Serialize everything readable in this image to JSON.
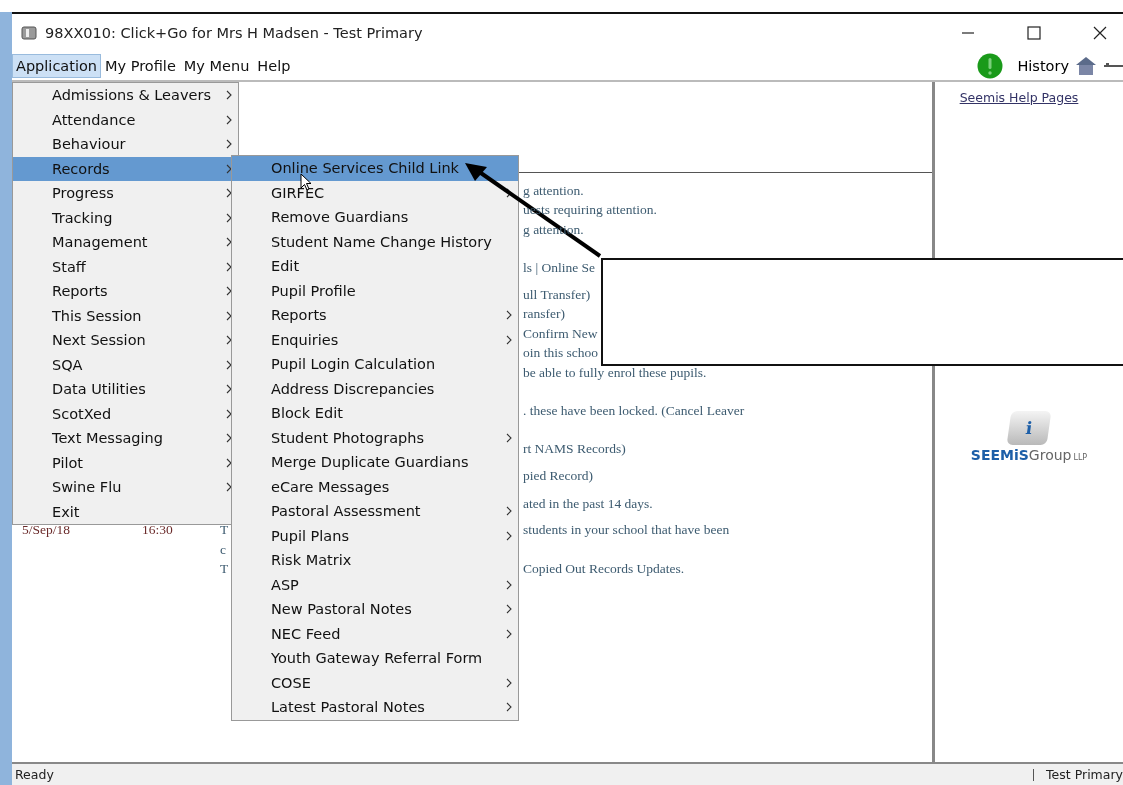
{
  "window": {
    "title": "98XX010: Click+Go for Mrs H Madsen - Test Primary"
  },
  "menubar": [
    {
      "label": "Application",
      "selected": true
    },
    {
      "label": "My Profile",
      "selected": false
    },
    {
      "label": "My Menu",
      "selected": false
    },
    {
      "label": "Help",
      "selected": false
    }
  ],
  "toolbar": {
    "history": "History"
  },
  "application_menu": [
    {
      "label": "Admissions & Leavers",
      "submenu": true,
      "selected": false
    },
    {
      "label": "Attendance",
      "submenu": true,
      "selected": false
    },
    {
      "label": "Behaviour",
      "submenu": true,
      "selected": false
    },
    {
      "label": "Records",
      "submenu": true,
      "selected": true
    },
    {
      "label": "Progress",
      "submenu": true,
      "selected": false
    },
    {
      "label": "Tracking",
      "submenu": true,
      "selected": false
    },
    {
      "label": "Management",
      "submenu": true,
      "selected": false
    },
    {
      "label": "Staff",
      "submenu": true,
      "selected": false
    },
    {
      "label": "Reports",
      "submenu": true,
      "selected": false
    },
    {
      "label": "This Session",
      "submenu": true,
      "selected": false
    },
    {
      "label": "Next Session",
      "submenu": true,
      "selected": false
    },
    {
      "label": "SQA",
      "submenu": true,
      "selected": false
    },
    {
      "label": "Data Utilities",
      "submenu": true,
      "selected": false
    },
    {
      "label": "ScotXed",
      "submenu": true,
      "selected": false
    },
    {
      "label": "Text Messaging",
      "submenu": true,
      "selected": false
    },
    {
      "label": "Pilot",
      "submenu": true,
      "selected": false
    },
    {
      "label": "Swine Flu",
      "submenu": true,
      "selected": false
    },
    {
      "label": "Exit",
      "submenu": false,
      "selected": false
    }
  ],
  "records_menu": [
    {
      "label": "Online Services Child Link",
      "submenu": false,
      "selected": true
    },
    {
      "label": "GIRFEC",
      "submenu": true,
      "selected": false
    },
    {
      "label": "Remove Guardians",
      "submenu": false,
      "selected": false
    },
    {
      "label": "Student Name Change History",
      "submenu": false,
      "selected": false
    },
    {
      "label": "Edit",
      "submenu": false,
      "selected": false
    },
    {
      "label": "Pupil Profile",
      "submenu": false,
      "selected": false
    },
    {
      "label": "Reports",
      "submenu": true,
      "selected": false
    },
    {
      "label": "Enquiries",
      "submenu": true,
      "selected": false
    },
    {
      "label": "Pupil Login Calculation",
      "submenu": false,
      "selected": false
    },
    {
      "label": "Address Discrepancies",
      "submenu": false,
      "selected": false
    },
    {
      "label": "Block Edit",
      "submenu": false,
      "selected": false
    },
    {
      "label": "Student Photographs",
      "submenu": true,
      "selected": false
    },
    {
      "label": "Merge Duplicate Guardians",
      "submenu": false,
      "selected": false
    },
    {
      "label": "eCare Messages",
      "submenu": false,
      "selected": false
    },
    {
      "label": "Pastoral Assessment",
      "submenu": true,
      "selected": false
    },
    {
      "label": "Pupil Plans",
      "submenu": true,
      "selected": false
    },
    {
      "label": "Risk Matrix",
      "submenu": false,
      "selected": false
    },
    {
      "label": "ASP",
      "submenu": true,
      "selected": false
    },
    {
      "label": "New Pastoral Notes",
      "submenu": true,
      "selected": false
    },
    {
      "label": "NEC Feed",
      "submenu": true,
      "selected": false
    },
    {
      "label": "Youth Gateway Referral Form",
      "submenu": false,
      "selected": false
    },
    {
      "label": "COSE",
      "submenu": true,
      "selected": false
    },
    {
      "label": "Latest Pastoral Notes",
      "submenu": true,
      "selected": false
    }
  ],
  "notices": [
    {
      "text": "g attention."
    },
    {
      "text": "uests requiring attention."
    },
    {
      "text": "g attention."
    },
    {
      "text": "ls | Online Se"
    },
    {
      "text": "ull Transfer)"
    },
    {
      "text": "ransfer)"
    },
    {
      "text": "Confirm New"
    },
    {
      "text": "oin this schoo"
    },
    {
      "text": "be able to fully enrol these pupils."
    },
    {
      "text": ". these have been locked. (Cancel Leaver"
    },
    {
      "text": "rt NAMS Records)"
    },
    {
      "text": "pied Record)"
    },
    {
      "text": "ated in the past 14 days."
    },
    {
      "date": "5/Sep/18",
      "time": "16:30",
      "note": "T",
      "text": "students in your school that have been"
    },
    {
      "note": "c"
    },
    {
      "note": "T",
      "text": "Copied Out Records Updates."
    }
  ],
  "side_panel": {
    "link": "Seemis Help Pages",
    "logo": {
      "key": "i",
      "brand": "SEEMiS",
      "name": "Group",
      "suffix": "LLP"
    }
  },
  "status_bar": {
    "left": "Ready",
    "right": "Test Primary"
  }
}
